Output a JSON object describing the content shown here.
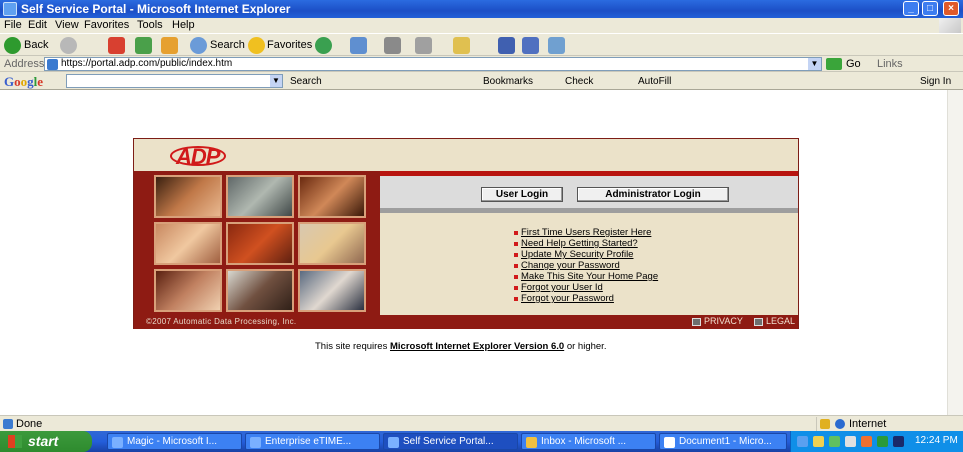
{
  "window": {
    "title": "Self Service Portal - Microsoft Internet Explorer"
  },
  "menu": [
    "File",
    "Edit",
    "View",
    "Favorites",
    "Tools",
    "Help"
  ],
  "toolbar": {
    "back": "Back",
    "search": "Search",
    "favorites": "Favorites"
  },
  "address": {
    "label": "Address",
    "url": "https://portal.adp.com/public/index.htm",
    "go": "Go",
    "links": "Links"
  },
  "googlebar": {
    "logo": [
      "G",
      "o",
      "o",
      "g",
      "l",
      "e"
    ],
    "search": "Search",
    "bookmarks": "Bookmarks",
    "check": "Check",
    "autofill": "AutoFill",
    "signin": "Sign In"
  },
  "portal": {
    "logo": "ADP",
    "user_login": "User Login",
    "admin_login": "Administrator Login",
    "links": [
      "First Time Users Register Here",
      "Need Help Getting Started?",
      "Update My Security Profile",
      "Change your Password",
      "Make This Site Your Home Page",
      "Forgot your User Id",
      "Forgot your Password"
    ],
    "copyright": "©2007 Automatic Data Processing, Inc.",
    "privacy": "PRIVACY",
    "legal": "LEGAL"
  },
  "requires": {
    "prefix": "This site requires ",
    "browser": "Microsoft Internet Explorer Version 6.0",
    "suffix": " or higher."
  },
  "status": {
    "text": "Done",
    "zone": "Internet"
  },
  "taskbar": {
    "start": "start",
    "tasks": [
      "Magic - Microsoft I...",
      "Enterprise eTIME...",
      "Self Service Portal...",
      "Inbox - Microsoft ...",
      "Document1 - Micro..."
    ],
    "clock": "12:24 PM"
  },
  "colors": {
    "brand_red": "#d11a1a",
    "panel_maroon": "#8e1b13",
    "panel_beige": "#ebe2c9",
    "titlebar_blue": "#1c4fc6"
  }
}
